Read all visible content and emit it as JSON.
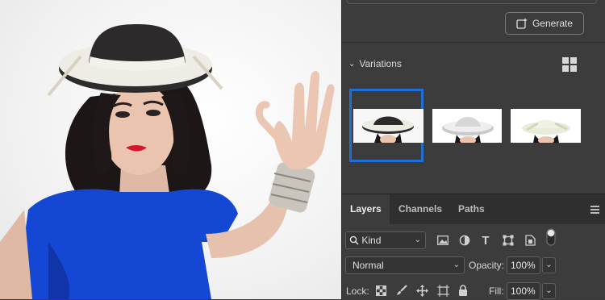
{
  "generative_panel": {
    "generate_label": "Generate",
    "variations_label": "Variations"
  },
  "layers_panel": {
    "tabs": [
      {
        "label": "Layers",
        "active": true
      },
      {
        "label": "Channels",
        "active": false
      },
      {
        "label": "Paths",
        "active": false
      }
    ],
    "filter": {
      "label": "Kind"
    },
    "blend_mode": "Normal",
    "opacity_label": "Opacity:",
    "opacity_value": "100%",
    "lock_label": "Lock:",
    "fill_label": "Fill:",
    "fill_value": "100%"
  },
  "colors": {
    "panel_bg": "#3c3c3c",
    "tab_bg": "#2f2f2f",
    "selection_accent": "#1f6fd6",
    "dress_blue": "#1448d4"
  }
}
